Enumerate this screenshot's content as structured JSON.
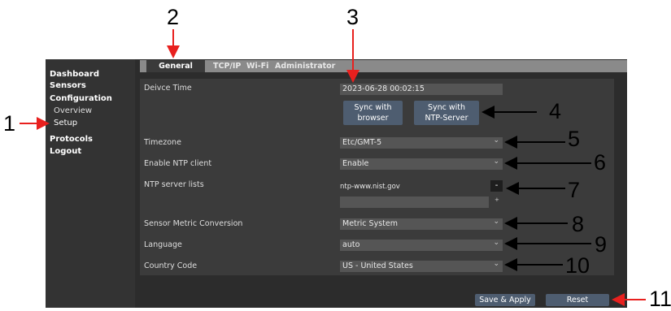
{
  "sidebar": {
    "items": [
      "Dashboard",
      "Sensors",
      "Configuration",
      "Protocols",
      "Logout"
    ],
    "sub_items": [
      "Overview",
      "Setup"
    ]
  },
  "tabs": [
    "General",
    "TCP/IP",
    "Wi-Fi",
    "Administrator"
  ],
  "general": {
    "device_time_label": "Deivce Time",
    "device_time_value": "2023-06-28 00:02:15",
    "sync_browser_line1": "Sync with",
    "sync_browser_line2": "browser",
    "sync_ntp_line1": "Sync with",
    "sync_ntp_line2": "NTP-Server",
    "timezone_label": "Timezone",
    "timezone_value": "Etc/GMT-5",
    "ntp_enable_label": "Enable NTP client",
    "ntp_enable_value": "Enable",
    "ntp_servers_label": "NTP server lists",
    "ntp_server_1": "ntp-www.nist.gov",
    "ntp_remove_symbol": "-",
    "ntp_add_symbol": "+",
    "metric_label": "Sensor Metric Conversion",
    "metric_value": "Metric System",
    "language_label": "Language",
    "language_value": "auto",
    "country_label": "Country Code",
    "country_value": "US - United States"
  },
  "footer": {
    "save_label": "Save & Apply",
    "reset_label": "Reset"
  },
  "annotations": [
    "1",
    "2",
    "3",
    "4",
    "5",
    "6",
    "7",
    "8",
    "9",
    "10",
    "11"
  ],
  "colors": {
    "annotation_arrow_red": "#e8201e",
    "annotation_arrow_black": "#000000",
    "button_blue": "#4e5d70",
    "panel_bg": "#3b3b3b"
  }
}
